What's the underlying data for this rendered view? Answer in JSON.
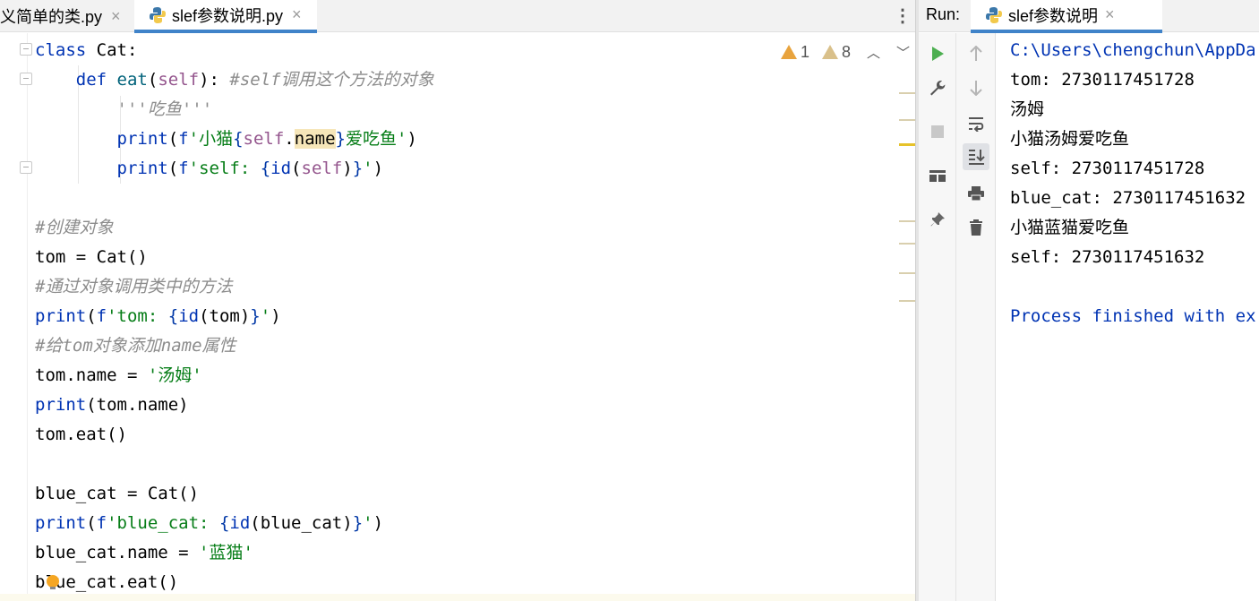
{
  "editor_tabs": [
    {
      "label": "义简单的类.py",
      "close": "×"
    },
    {
      "label": "slef参数说明.py",
      "close": "×"
    }
  ],
  "inspection": {
    "errors": "1",
    "warnings": "8"
  },
  "code_lines": [
    [
      [
        "kw",
        "class "
      ],
      [
        "",
        "Cat:"
      ]
    ],
    [
      [
        "",
        "    "
      ],
      [
        "kw",
        "def "
      ],
      [
        "fn",
        "eat"
      ],
      [
        "",
        "("
      ],
      [
        "self",
        "self"
      ],
      [
        "",
        "): "
      ],
      [
        "cmt",
        "#self调用这个方法的对象"
      ]
    ],
    [
      [
        "",
        "        "
      ],
      [
        "cmt",
        "'''吃鱼'''"
      ]
    ],
    [
      [
        "",
        "        "
      ],
      [
        "kw",
        "print"
      ],
      [
        "",
        "("
      ],
      [
        "kw",
        "f"
      ],
      [
        "str",
        "'小猫"
      ],
      [
        "fbr",
        "{"
      ],
      [
        "self",
        "self"
      ],
      [
        "",
        "."
      ],
      [
        "hl",
        "name"
      ],
      [
        "fbr",
        "}"
      ],
      [
        "str",
        "爱吃鱼'"
      ],
      [
        "",
        ")"
      ]
    ],
    [
      [
        "",
        "        "
      ],
      [
        "kw",
        "print"
      ],
      [
        "",
        "("
      ],
      [
        "kw",
        "f"
      ],
      [
        "str",
        "'self: "
      ],
      [
        "fbr",
        "{"
      ],
      [
        "kw",
        "id"
      ],
      [
        "",
        "("
      ],
      [
        "self",
        "self"
      ],
      [
        "",
        ")"
      ],
      [
        "fbr",
        "}"
      ],
      [
        "str",
        "'"
      ],
      [
        "",
        ")"
      ]
    ],
    [],
    [
      [
        "cmt",
        "#创建对象"
      ]
    ],
    [
      [
        "",
        "tom = Cat()"
      ]
    ],
    [
      [
        "cmt",
        "#通过对象调用类中的方法"
      ]
    ],
    [
      [
        "kw",
        "print"
      ],
      [
        "",
        "("
      ],
      [
        "kw",
        "f"
      ],
      [
        "str",
        "'tom: "
      ],
      [
        "fbr",
        "{"
      ],
      [
        "kw",
        "id"
      ],
      [
        "",
        "(tom)"
      ],
      [
        "fbr",
        "}"
      ],
      [
        "str",
        "'"
      ],
      [
        "",
        ")"
      ]
    ],
    [
      [
        "cmt",
        "#给tom对象添加name属性"
      ]
    ],
    [
      [
        "",
        "tom.name = "
      ],
      [
        "str",
        "'汤姆'"
      ]
    ],
    [
      [
        "kw",
        "print"
      ],
      [
        "",
        "(tom.name)"
      ]
    ],
    [
      [
        "",
        "tom.eat()"
      ]
    ],
    [],
    [
      [
        "",
        "blue_cat = Cat()"
      ]
    ],
    [
      [
        "kw",
        "print"
      ],
      [
        "",
        "("
      ],
      [
        "kw",
        "f"
      ],
      [
        "str",
        "'blue_cat: "
      ],
      [
        "fbr",
        "{"
      ],
      [
        "kw",
        "id"
      ],
      [
        "",
        "(blue_cat)"
      ],
      [
        "fbr",
        "}"
      ],
      [
        "str",
        "'"
      ],
      [
        "",
        ")"
      ]
    ],
    [
      [
        "",
        "blue_cat.name = "
      ],
      [
        "str",
        "'蓝猫'"
      ]
    ],
    [
      [
        "",
        "blue_cat.eat()"
      ]
    ]
  ],
  "run_panel": {
    "label": "Run:",
    "tab_label": "slef参数说明",
    "close": "×",
    "console_lines": [
      {
        "cls": "path",
        "text": "C:\\Users\\chengchun\\AppDa"
      },
      {
        "cls": "",
        "text": "tom: 2730117451728"
      },
      {
        "cls": "",
        "text": "汤姆"
      },
      {
        "cls": "",
        "text": "小猫汤姆爱吃鱼"
      },
      {
        "cls": "",
        "text": "self: 2730117451728"
      },
      {
        "cls": "",
        "text": "blue_cat: 2730117451632"
      },
      {
        "cls": "",
        "text": "小猫蓝猫爱吃鱼"
      },
      {
        "cls": "",
        "text": "self: 2730117451632"
      },
      {
        "cls": "",
        "text": ""
      },
      {
        "cls": "finish",
        "text": "Process finished with ex"
      }
    ]
  },
  "colors": {
    "keyword": "#0033b3",
    "function": "#00627a",
    "self": "#94558d",
    "string": "#067d17",
    "comment": "#8c8c8c",
    "run_green": "#4caf50",
    "tab_underline": "#4083c9"
  },
  "icons": {
    "run": "play-icon",
    "wrench": "wrench-icon",
    "stop": "stop-icon",
    "layout": "layout-icon",
    "pin": "pin-icon",
    "up": "arrow-up-icon",
    "down": "arrow-down-icon",
    "wrap": "soft-wrap-icon",
    "scroll_end": "scroll-to-end-icon",
    "print": "print-icon",
    "trash": "trash-icon"
  }
}
